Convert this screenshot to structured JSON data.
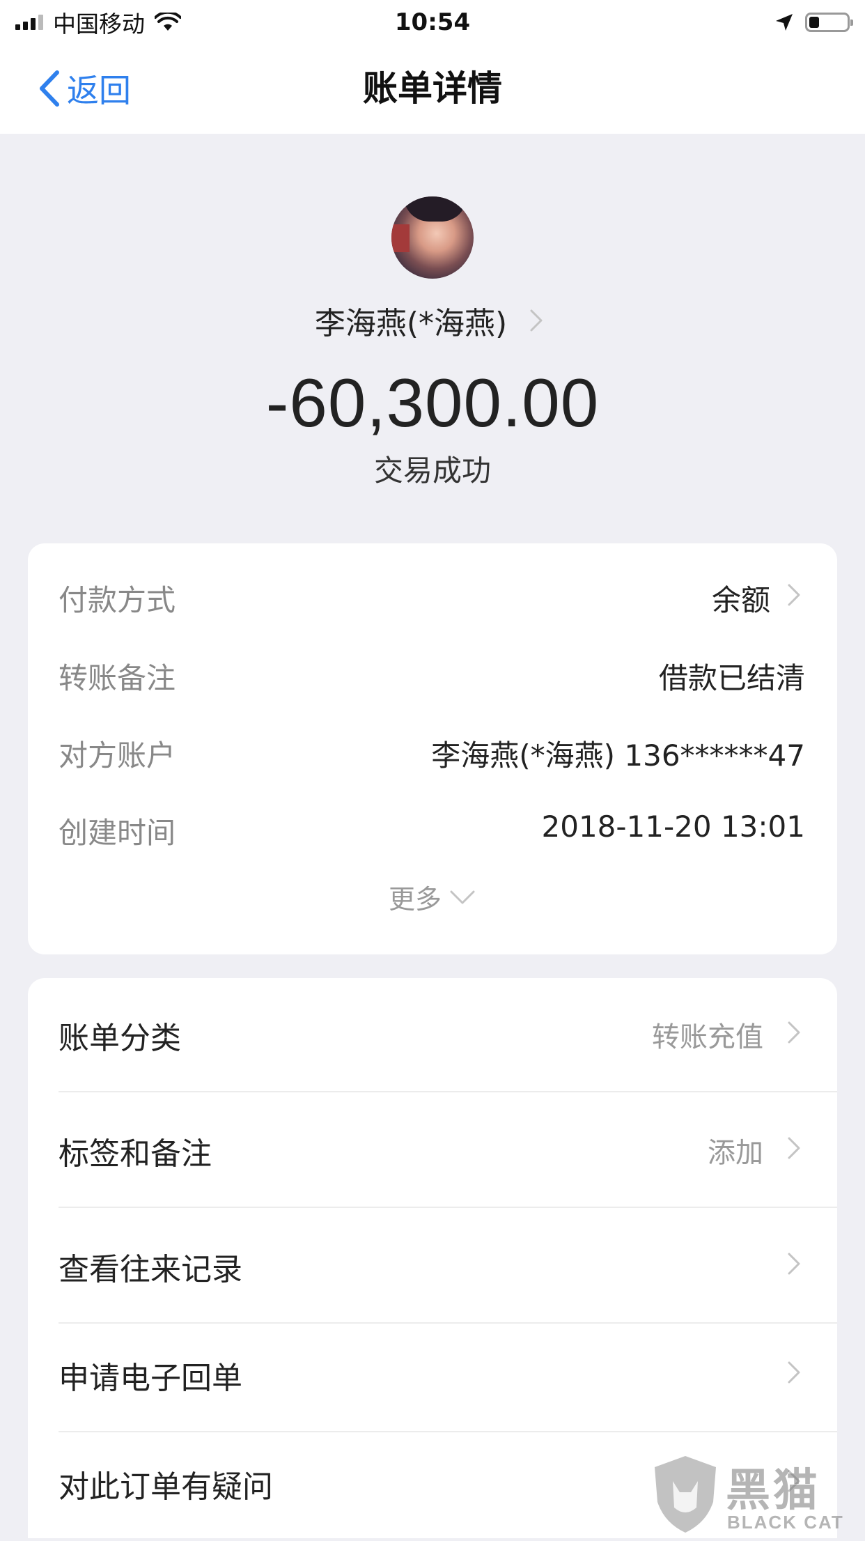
{
  "status_bar": {
    "carrier": "中国移动",
    "time": "10:54"
  },
  "nav": {
    "back_label": "返回",
    "title": "账单详情"
  },
  "header": {
    "payee_name": "李海燕(*海燕)",
    "amount": "-60,300.00",
    "status": "交易成功"
  },
  "details": {
    "rows": [
      {
        "label": "付款方式",
        "value": "余额"
      },
      {
        "label": "转账备注",
        "value": "借款已结清"
      },
      {
        "label": "对方账户",
        "value": "李海燕(*海燕) 136******47"
      },
      {
        "label": "创建时间",
        "value": "2018-11-20 13:01"
      }
    ],
    "more_label": "更多"
  },
  "links": {
    "rows": [
      {
        "label": "账单分类",
        "value": "转账充值"
      },
      {
        "label": "标签和备注",
        "value": "添加"
      },
      {
        "label": "查看往来记录",
        "value": ""
      },
      {
        "label": "申请电子回单",
        "value": ""
      },
      {
        "label": "对此订单有疑问",
        "value": ""
      }
    ]
  },
  "watermark": {
    "text": "黑猫",
    "subtext": "BLACK CAT"
  },
  "colors": {
    "accent": "#2f80ed",
    "background": "#efeff4",
    "label_gray": "#888888"
  }
}
